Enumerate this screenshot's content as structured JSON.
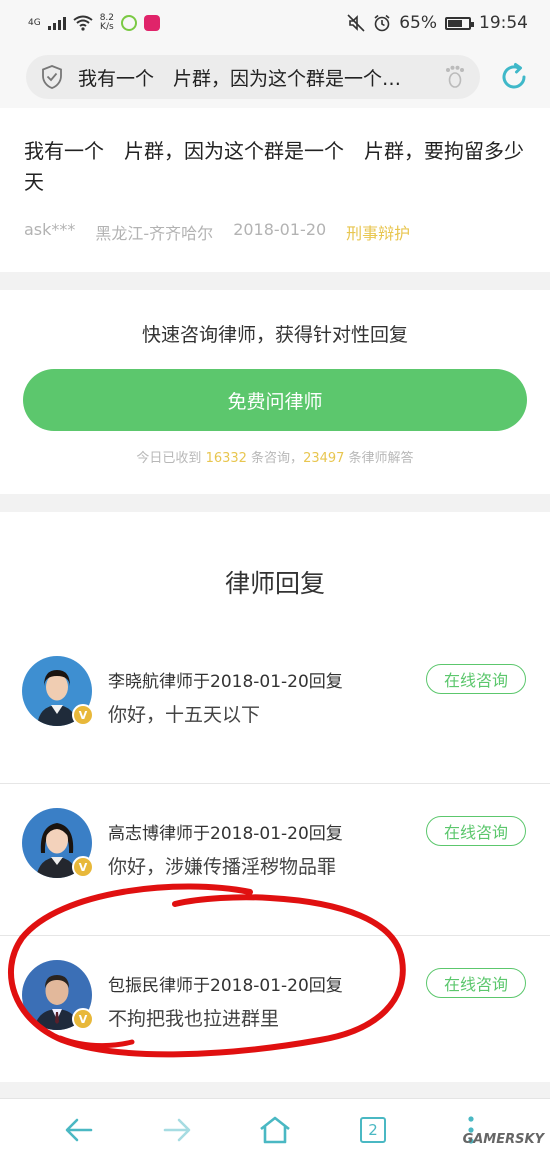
{
  "status_bar": {
    "network": "4G",
    "speed_value": "8.2",
    "speed_unit": "K/s",
    "battery": "65%",
    "time": "19:54"
  },
  "search": {
    "text": "我有一个　片群，因为这个群是一个…"
  },
  "question": {
    "title": "我有一个　片群，因为这个群是一个　片群，要拘留多少天",
    "user": "ask***",
    "location": "黑龙江-齐齐哈尔",
    "date": "2018-01-20",
    "tag": "刑事辩护"
  },
  "consult": {
    "title": "快速咨询律师，获得针对性回复",
    "button_label": "免费问律师",
    "stats_prefix": "今日已收到 ",
    "stats_consults": "16332",
    "stats_mid": " 条咨询，",
    "stats_answers": "23497",
    "stats_suffix": " 条律师解答"
  },
  "replies": {
    "heading": "律师回复",
    "items": [
      {
        "name": "李晓航律师于2018-01-20回复",
        "text": "你好，十五天以下",
        "button": "在线咨询"
      },
      {
        "name": "高志博律师于2018-01-20回复",
        "text": "你好，涉嫌传播淫秽物品罪",
        "button": "在线咨询"
      },
      {
        "name": "包振民律师于2018-01-20回复",
        "text": "不拘把我也拉进群里",
        "button": "在线咨询"
      }
    ],
    "badge": "V"
  },
  "nav": {
    "tab_count": "2"
  },
  "watermark": "GAMERSKY",
  "colors": {
    "accent_green": "#5cc76d",
    "tag_yellow": "#e8c650",
    "icon_teal": "#4ab8c3",
    "annotation_red": "#e01010"
  }
}
